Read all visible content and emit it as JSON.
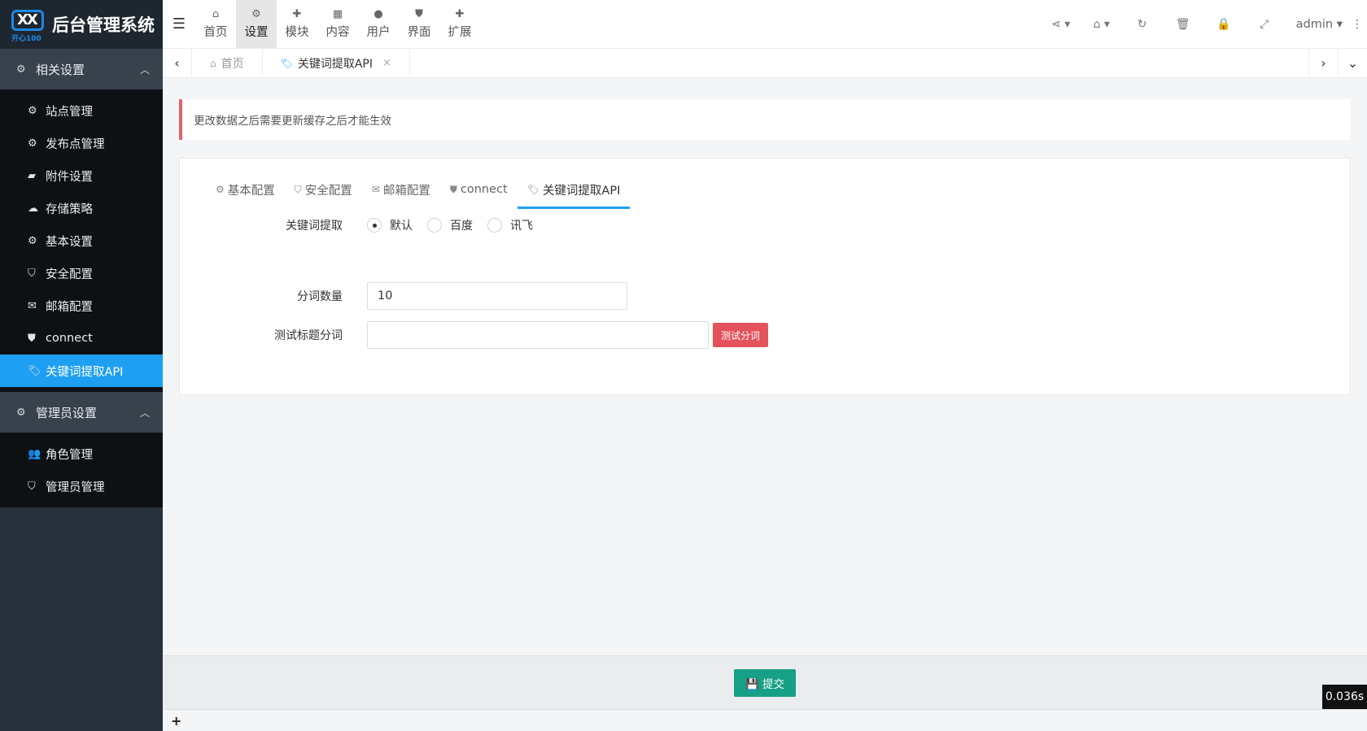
{
  "app": {
    "title": "后台管理系统",
    "logo_text": "XX",
    "logo_sub": "开心100"
  },
  "sidebar": {
    "groups": [
      {
        "label": "相关设置",
        "icon": "cogs-icon",
        "items": [
          {
            "label": "站点管理",
            "icon": "gear-icon"
          },
          {
            "label": "发布点管理",
            "icon": "cogs-icon"
          },
          {
            "label": "附件设置",
            "icon": "folder-icon"
          },
          {
            "label": "存储策略",
            "icon": "cloud-icon"
          },
          {
            "label": "基本设置",
            "icon": "gear-icon"
          },
          {
            "label": "安全配置",
            "icon": "shield-icon"
          },
          {
            "label": "邮箱配置",
            "icon": "envelope-icon"
          },
          {
            "label": "connect",
            "icon": "html5-icon"
          },
          {
            "label": "关键词提取API",
            "icon": "tags-icon",
            "active": true
          }
        ]
      },
      {
        "label": "管理员设置",
        "icon": "cog-icon",
        "items": [
          {
            "label": "角色管理",
            "icon": "users-icon"
          },
          {
            "label": "管理员管理",
            "icon": "shield-icon"
          }
        ]
      }
    ]
  },
  "topnav": [
    {
      "label": "首页",
      "icon": "home-icon"
    },
    {
      "label": "设置",
      "icon": "cogs-icon",
      "active": true
    },
    {
      "label": "模块",
      "icon": "puzzle-icon"
    },
    {
      "label": "内容",
      "icon": "grid-icon"
    },
    {
      "label": "用户",
      "icon": "user-icon"
    },
    {
      "label": "界面",
      "icon": "html5-icon"
    },
    {
      "label": "扩展",
      "icon": "puzzle-icon"
    }
  ],
  "header_right": {
    "user": "admin"
  },
  "tabstrip": {
    "tabs": [
      {
        "label": "首页"
      },
      {
        "label": "关键词提取API",
        "current": true
      }
    ]
  },
  "notice": {
    "text": "更改数据之后需要更新缓存之后才能生效"
  },
  "panel": {
    "tabs": [
      {
        "label": "基本配置",
        "icon": "gear-icon"
      },
      {
        "label": "安全配置",
        "icon": "shield-icon"
      },
      {
        "label": "邮箱配置",
        "icon": "envelope-icon"
      },
      {
        "label": "connect",
        "icon": "html5-icon"
      },
      {
        "label": "关键词提取API",
        "icon": "tags-icon",
        "active": true
      }
    ],
    "form": {
      "keyword_label": "关键词提取",
      "options": [
        {
          "label": "默认",
          "checked": true
        },
        {
          "label": "百度",
          "checked": false
        },
        {
          "label": "讯飞",
          "checked": false
        }
      ],
      "count_label": "分词数量",
      "count_value": "10",
      "test_label": "测试标题分词",
      "test_value": "",
      "test_button": "测试分词"
    }
  },
  "footer": {
    "submit_label": "提交"
  },
  "timer": "0.036s"
}
